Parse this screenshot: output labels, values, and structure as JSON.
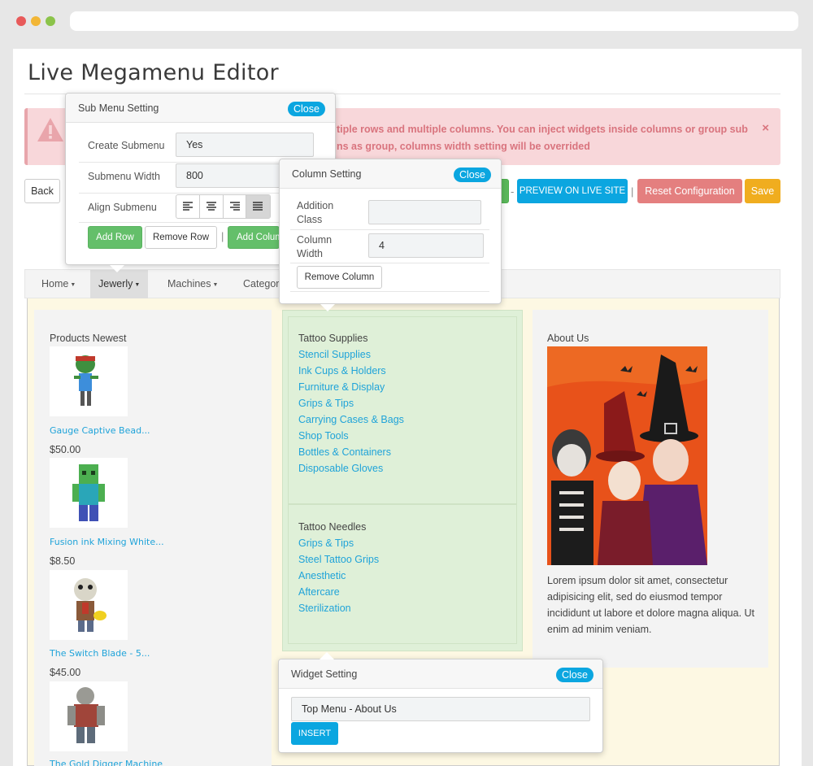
{
  "page": {
    "title": "Live Megamenu Editor"
  },
  "alert": {
    "text": "tiple rows and multiple columns. You can inject widgets inside columns or group sub ns as group, columns width setting will be overrided",
    "close": "×"
  },
  "toolbar": {
    "back": "Back",
    "dash": "-",
    "preview": "PREVIEW ON LIVE SITE",
    "pipe": "|",
    "reset": "Reset Configuration",
    "save": "Save"
  },
  "nav": {
    "items": [
      "Home",
      "Jewerly",
      "Machines",
      "Categor"
    ]
  },
  "columns": {
    "col1": {
      "heading": "Products Newest",
      "products": [
        {
          "name": "Gauge Captive Bead...",
          "price": "$50.00"
        },
        {
          "name": "Fusion ink Mixing White...",
          "price": "$8.50"
        },
        {
          "name": "The Switch Blade - 5...",
          "price": "$45.00"
        },
        {
          "name": "The Gold Digger Machine",
          "price": ""
        }
      ]
    },
    "col2": {
      "group1": {
        "heading": "Tattoo Supplies",
        "links": [
          "Stencil Supplies",
          "Ink Cups & Holders",
          "Furniture & Display",
          "Grips & Tips",
          "Carrying Cases & Bags",
          "Shop Tools",
          "Bottles & Containers",
          "Disposable Gloves"
        ]
      },
      "group2": {
        "heading": "Tattoo Needles",
        "links": [
          "Grips & Tips",
          "Steel Tattoo Grips",
          "Anesthetic",
          "Aftercare",
          "Sterilization"
        ]
      }
    },
    "col3": {
      "heading": "About Us",
      "text": "Lorem ipsum dolor sit amet, consectetur adipisicing elit, sed do eiusmod tempor incididunt ut labore et dolore magna aliqua. Ut enim ad minim veniam."
    }
  },
  "submenu_popover": {
    "title": "Sub Menu Setting",
    "close": "Close",
    "create_label": "Create Submenu",
    "create_value": "Yes",
    "width_label": "Submenu Width",
    "width_value": "800",
    "align_label": "Align Submenu",
    "add_row": "Add Row",
    "remove_row": "Remove Row",
    "pipe": "|",
    "add_column": "Add Column"
  },
  "column_popover": {
    "title": "Column Setting",
    "close": "Close",
    "class_label": "Addition Class",
    "class_value": "",
    "width_label": "Column Width",
    "width_value": "4",
    "remove_column": "Remove Column"
  },
  "widget_popover": {
    "title": "Widget Setting",
    "close": "Close",
    "widget_value": "Top Menu - About Us",
    "insert": "INSERT"
  },
  "colors": {
    "accent": "#0ba6e0",
    "green": "#64bf6a",
    "danger": "#e47f7f",
    "warning": "#f0ad1f",
    "link": "#1fa3d9"
  }
}
